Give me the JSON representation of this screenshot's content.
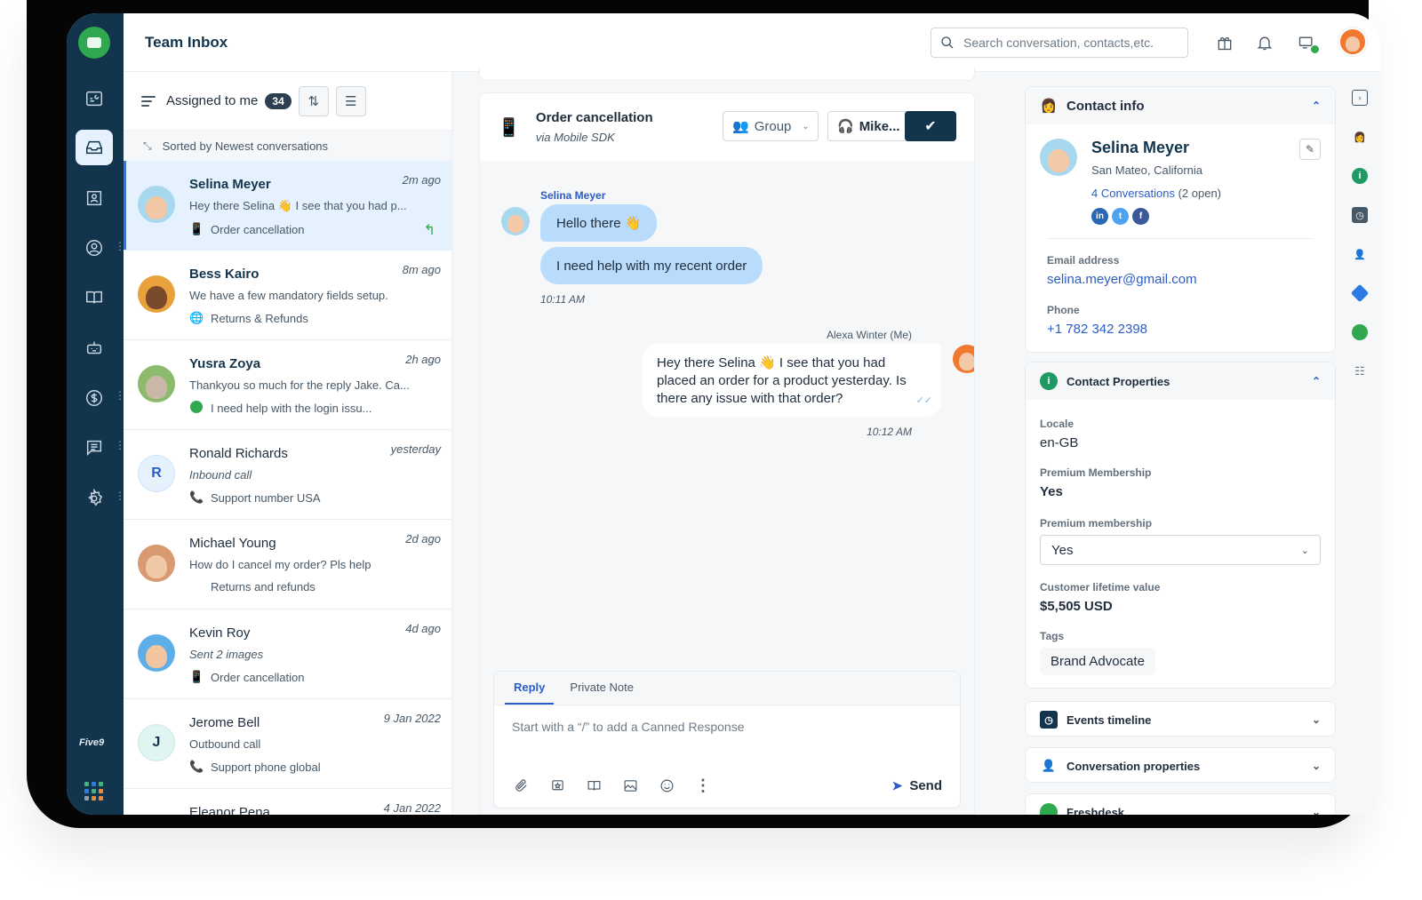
{
  "header": {
    "title": "Team Inbox",
    "search_placeholder": "Search conversation, contacts,etc."
  },
  "nav": {
    "items": [
      "dashboard",
      "inbox",
      "contacts",
      "customers",
      "knowledge-base",
      "bot",
      "billing",
      "chat",
      "settings"
    ],
    "active": "inbox",
    "brand_footer": "Five9"
  },
  "list": {
    "filter_label": "Assigned to me",
    "count": "34",
    "sorted_label": "Sorted by Newest conversations",
    "conversations": [
      {
        "name": "Selina Meyer",
        "time": "2m ago",
        "preview": "Hey there Selina 👋 I see that you had p...",
        "channel_icon": "mobile-icon",
        "topic": "Order cancellation",
        "active": true
      },
      {
        "name": "Bess Kairo",
        "time": "8m ago",
        "preview": "We have a few mandatory fields setup.",
        "channel_icon": "globe-icon",
        "topic": "Returns & Refunds"
      },
      {
        "name": "Yusra Zoya",
        "time": "2h ago",
        "preview": "Thankyou so much for the reply Jake. Ca...",
        "channel_icon": "whatsapp-icon",
        "topic": "I need help with the login issu..."
      },
      {
        "name": "Ronald Richards",
        "initial": "R",
        "time": "yesterday",
        "preview": "Inbound call",
        "channel_icon": "phone-icon",
        "topic": "Support number USA"
      },
      {
        "name": "Michael Young",
        "time": "2d ago",
        "preview": "How do I cancel my order? Pls help",
        "channel_icon": "apple-icon",
        "topic": "Returns and refunds"
      },
      {
        "name": "Kevin Roy",
        "time": "4d ago",
        "preview": "Sent 2 images",
        "channel_icon": "mobile-icon",
        "topic": "Order cancellation"
      },
      {
        "name": "Jerome Bell",
        "initial": "J",
        "time": "9 Jan 2022",
        "preview": "Outbound call",
        "channel_icon": "phone-icon",
        "topic": "Support phone global"
      },
      {
        "name": "Eleanor Pena",
        "time": "4 Jan 2022"
      }
    ]
  },
  "chat": {
    "title": "Order cancellation",
    "subtitle": "via Mobile SDK",
    "group_label": "Group",
    "agent_label": "Mike...",
    "incoming_sender": "Selina Meyer",
    "incoming_messages": [
      "Hello there 👋",
      "I need help with my recent order"
    ],
    "incoming_time": "10:11 AM",
    "outgoing_sender": "Alexa Winter (Me)",
    "outgoing_message": "Hey there Selina 👋 I see that you had placed an order for a product yesterday. Is there any issue with that order?",
    "outgoing_time": "10:12 AM",
    "composer": {
      "tabs": [
        "Reply",
        "Private Note"
      ],
      "active_tab": "Reply",
      "placeholder": "Start with a “/” to add a Canned Response",
      "send_label": "Send"
    }
  },
  "contact": {
    "section_title": "Contact info",
    "name": "Selina Meyer",
    "location": "San Mateo, California",
    "conversations_link": "4 Conversations",
    "conversations_open": "(2 open)",
    "email_label": "Email address",
    "email": "selina.meyer@gmail.com",
    "phone_label": "Phone",
    "phone": "+1 782 342 2398"
  },
  "properties": {
    "section_title": "Contact Properties",
    "locale_label": "Locale",
    "locale": "en-GB",
    "premium_label": "Premium Membership",
    "premium": "Yes",
    "premium_select_label": "Premium membership",
    "premium_select_value": "Yes",
    "clv_label": "Customer lifetime value",
    "clv": "$5,505 USD",
    "tags_label": "Tags",
    "tags": [
      "Brand Advocate"
    ]
  },
  "collapsed_sections": [
    "Events timeline",
    "Conversation properties",
    "Freshdesk"
  ],
  "colors": {
    "nav_bg": "#12344d",
    "accent": "#2c5cc5",
    "bubble_in": "#b9dcfd",
    "brand_green": "#2fa84f"
  }
}
